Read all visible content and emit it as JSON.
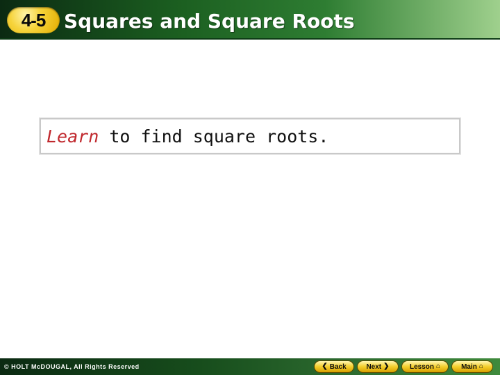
{
  "header": {
    "lesson_badge": "4-5",
    "title": "Squares and Square Roots"
  },
  "objective": {
    "lead": "Learn",
    "text": " to find square roots."
  },
  "footer": {
    "copyright": "© HOLT McDOUGAL, All Rights Reserved",
    "buttons": {
      "back": "Back",
      "next": "Next",
      "lesson": "Lesson",
      "main": "Main"
    }
  },
  "icons": {
    "back": "chevron-left-icon",
    "next": "chevron-right-icon",
    "lesson": "home-icon",
    "main": "home-icon"
  },
  "colors": {
    "header_green": "#1b5e20",
    "badge_yellow": "#f6d33a",
    "learn_red": "#c0282d"
  }
}
